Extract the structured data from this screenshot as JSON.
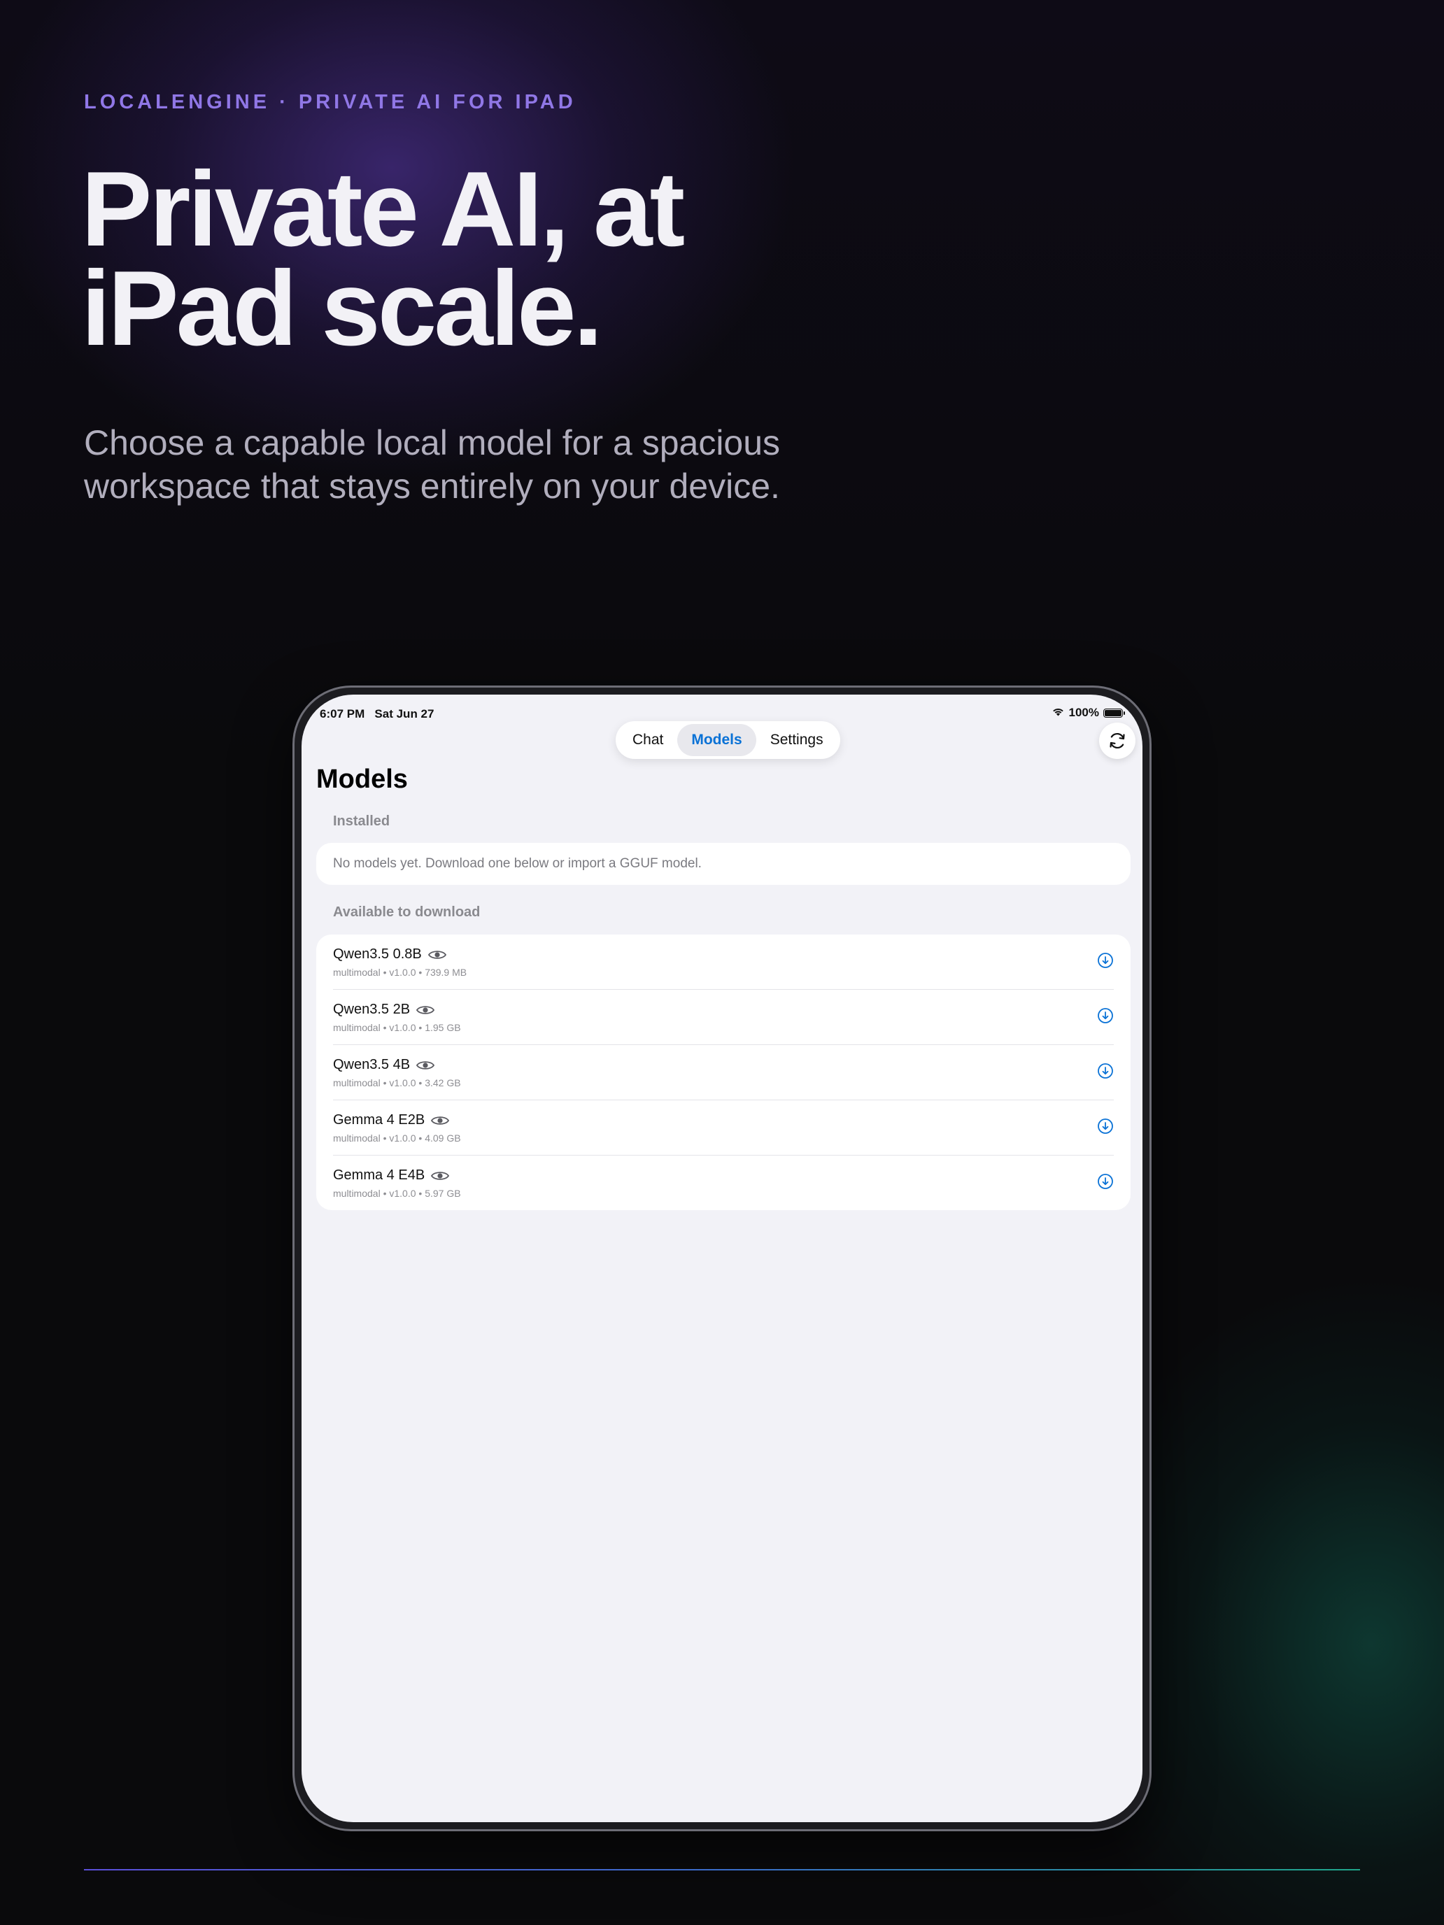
{
  "hero": {
    "eyebrow": "LOCALENGINE · PRIVATE AI FOR IPAD",
    "headline_line1": "Private AI, at",
    "headline_line2": "iPad scale.",
    "subhead_line1": "Choose a capable local model for a spacious",
    "subhead_line2": "workspace that stays entirely on your device."
  },
  "colors": {
    "accent": "#9077e6",
    "tab_active": "#0a72d6",
    "screen_bg": "#f2f2f7"
  },
  "status_bar": {
    "time": "6:07 PM",
    "date": "Sat Jun 27",
    "battery": "100%",
    "icons": [
      "wifi-icon",
      "battery-icon"
    ]
  },
  "tabs": [
    {
      "label": "Chat",
      "active": false
    },
    {
      "label": "Models",
      "active": true
    },
    {
      "label": "Settings",
      "active": false
    }
  ],
  "page": {
    "title": "Models",
    "installed_label": "Installed",
    "installed_empty": "No models yet. Download one below or import a GGUF model.",
    "available_label": "Available to download"
  },
  "models": [
    {
      "name": "Qwen3.5 0.8B",
      "meta": "multimodal • v1.0.0 • 739.9 MB"
    },
    {
      "name": "Qwen3.5 2B",
      "meta": "multimodal • v1.0.0 • 1.95 GB"
    },
    {
      "name": "Qwen3.5 4B",
      "meta": "multimodal • v1.0.0 • 3.42 GB"
    },
    {
      "name": "Gemma 4 E2B",
      "meta": "multimodal • v1.0.0 • 4.09 GB"
    },
    {
      "name": "Gemma 4 E4B",
      "meta": "multimodal • v1.0.0 • 5.97 GB"
    }
  ]
}
